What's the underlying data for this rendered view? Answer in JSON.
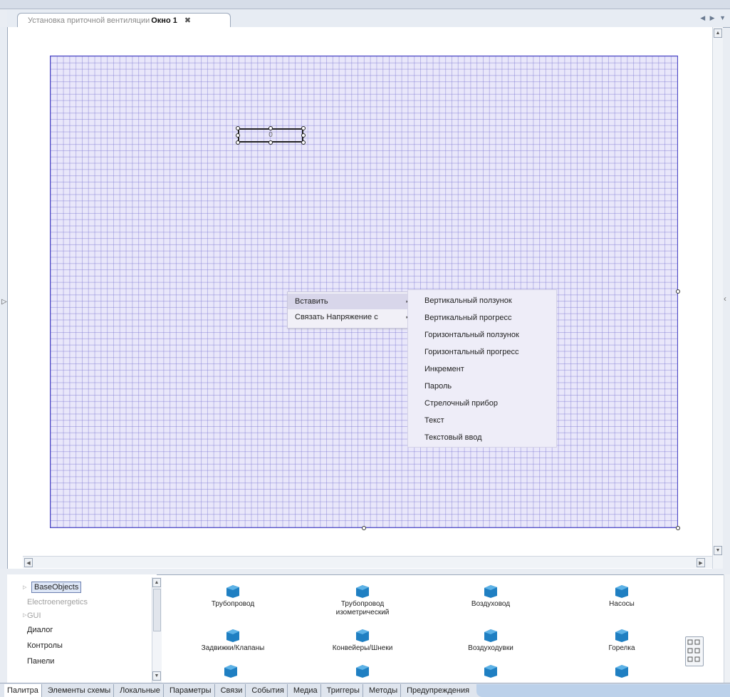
{
  "document_tab": {
    "path": "Установка приточной вентиляции",
    "name": "Окно 1",
    "close": "✖"
  },
  "tab_nav": "◀ ▶ ▼",
  "widget": {
    "value": "0"
  },
  "context_menu": {
    "items": [
      {
        "label": "Вставить",
        "arrow": "▸"
      },
      {
        "label": "Связать Напряжение с",
        "arrow": "▸"
      }
    ]
  },
  "submenu": {
    "items": [
      "Вертикальный ползунок",
      "Вертикальный прогресс",
      "Горизонтальный ползунок",
      "Горизонтальный прогресс",
      "Инкремент",
      "Пароль",
      "Стрелочный прибор",
      "Текст",
      "Текстовый ввод"
    ]
  },
  "tree": {
    "items": [
      {
        "label": "BaseObjects"
      },
      {
        "label": "Electroenergetics"
      },
      {
        "label": "GUI"
      },
      {
        "label": "Диалог"
      },
      {
        "label": "Контролы"
      },
      {
        "label": "Панели"
      }
    ]
  },
  "palette": {
    "categories": [
      [
        "Трубопровод",
        ""
      ],
      [
        "Трубопровод",
        "изометрический"
      ],
      [
        "Воздуховод",
        ""
      ],
      [
        "Насосы",
        ""
      ],
      [
        "Задвижки/Клапаны",
        ""
      ],
      [
        "Конвейеры/Шнеки",
        ""
      ],
      [
        "Воздуходувки",
        ""
      ],
      [
        "Горелка",
        ""
      ]
    ]
  },
  "bottom_tabs": [
    "Палитра",
    "Элементы схемы",
    "Локальные",
    "Параметры",
    "Связи",
    "События",
    "Медиа",
    "Триггеры",
    "Методы",
    "Предупреждения"
  ],
  "colors": {
    "canvas_bg": "#e9e7fa",
    "canvas_border": "#4b47c6",
    "menu_bg": "#f1f0f7",
    "selected_tree": "#dde6f6",
    "folder": "#1f7fc2"
  }
}
